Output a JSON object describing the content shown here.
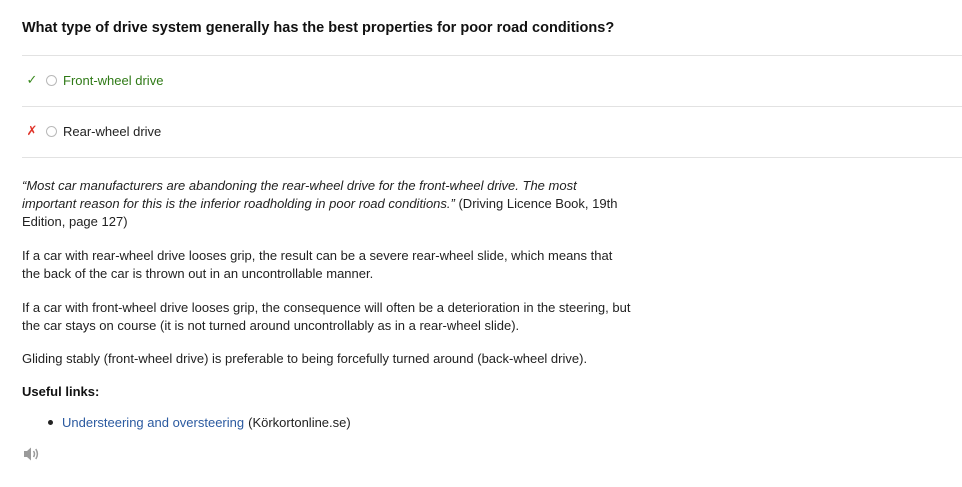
{
  "question": {
    "text": "What type of drive system generally has the best properties for poor road conditions?"
  },
  "options": [
    {
      "mark": "✓",
      "label": "Front-wheel drive",
      "status": "correct"
    },
    {
      "mark": "✗",
      "label": "Rear-wheel drive",
      "status": "incorrect"
    }
  ],
  "explanation": {
    "quote_italic": "“Most car manufacturers are abandoning the rear-wheel drive for the front-wheel drive. The most important reason for this is the inferior roadholding in poor road conditions.”",
    "quote_source": " (Driving Licence Book, 19th Edition, page 127)",
    "para2": "If a car with rear-wheel drive looses grip, the result can be a severe rear-wheel slide, which means that the back of the car is thrown out in an uncontrollable manner.",
    "para3": "If a car with front-wheel drive looses grip, the consequence will often be a deterioration in the steering, but the car stays on course (it is not turned around uncontrollably as in a rear-wheel slide).",
    "para4": "Gliding stably (front-wheel drive) is preferable to being forcefully turned around (back-wheel drive)."
  },
  "useful_links": {
    "heading": "Useful links:",
    "items": [
      {
        "text": "Understeering and oversteering",
        "source": "(Körkortonline.se)"
      }
    ]
  },
  "icons": {
    "speaker": "speaker-icon"
  },
  "colors": {
    "correct": "#2f7a16",
    "incorrect": "#e0342a",
    "link": "#2b5aa0"
  }
}
